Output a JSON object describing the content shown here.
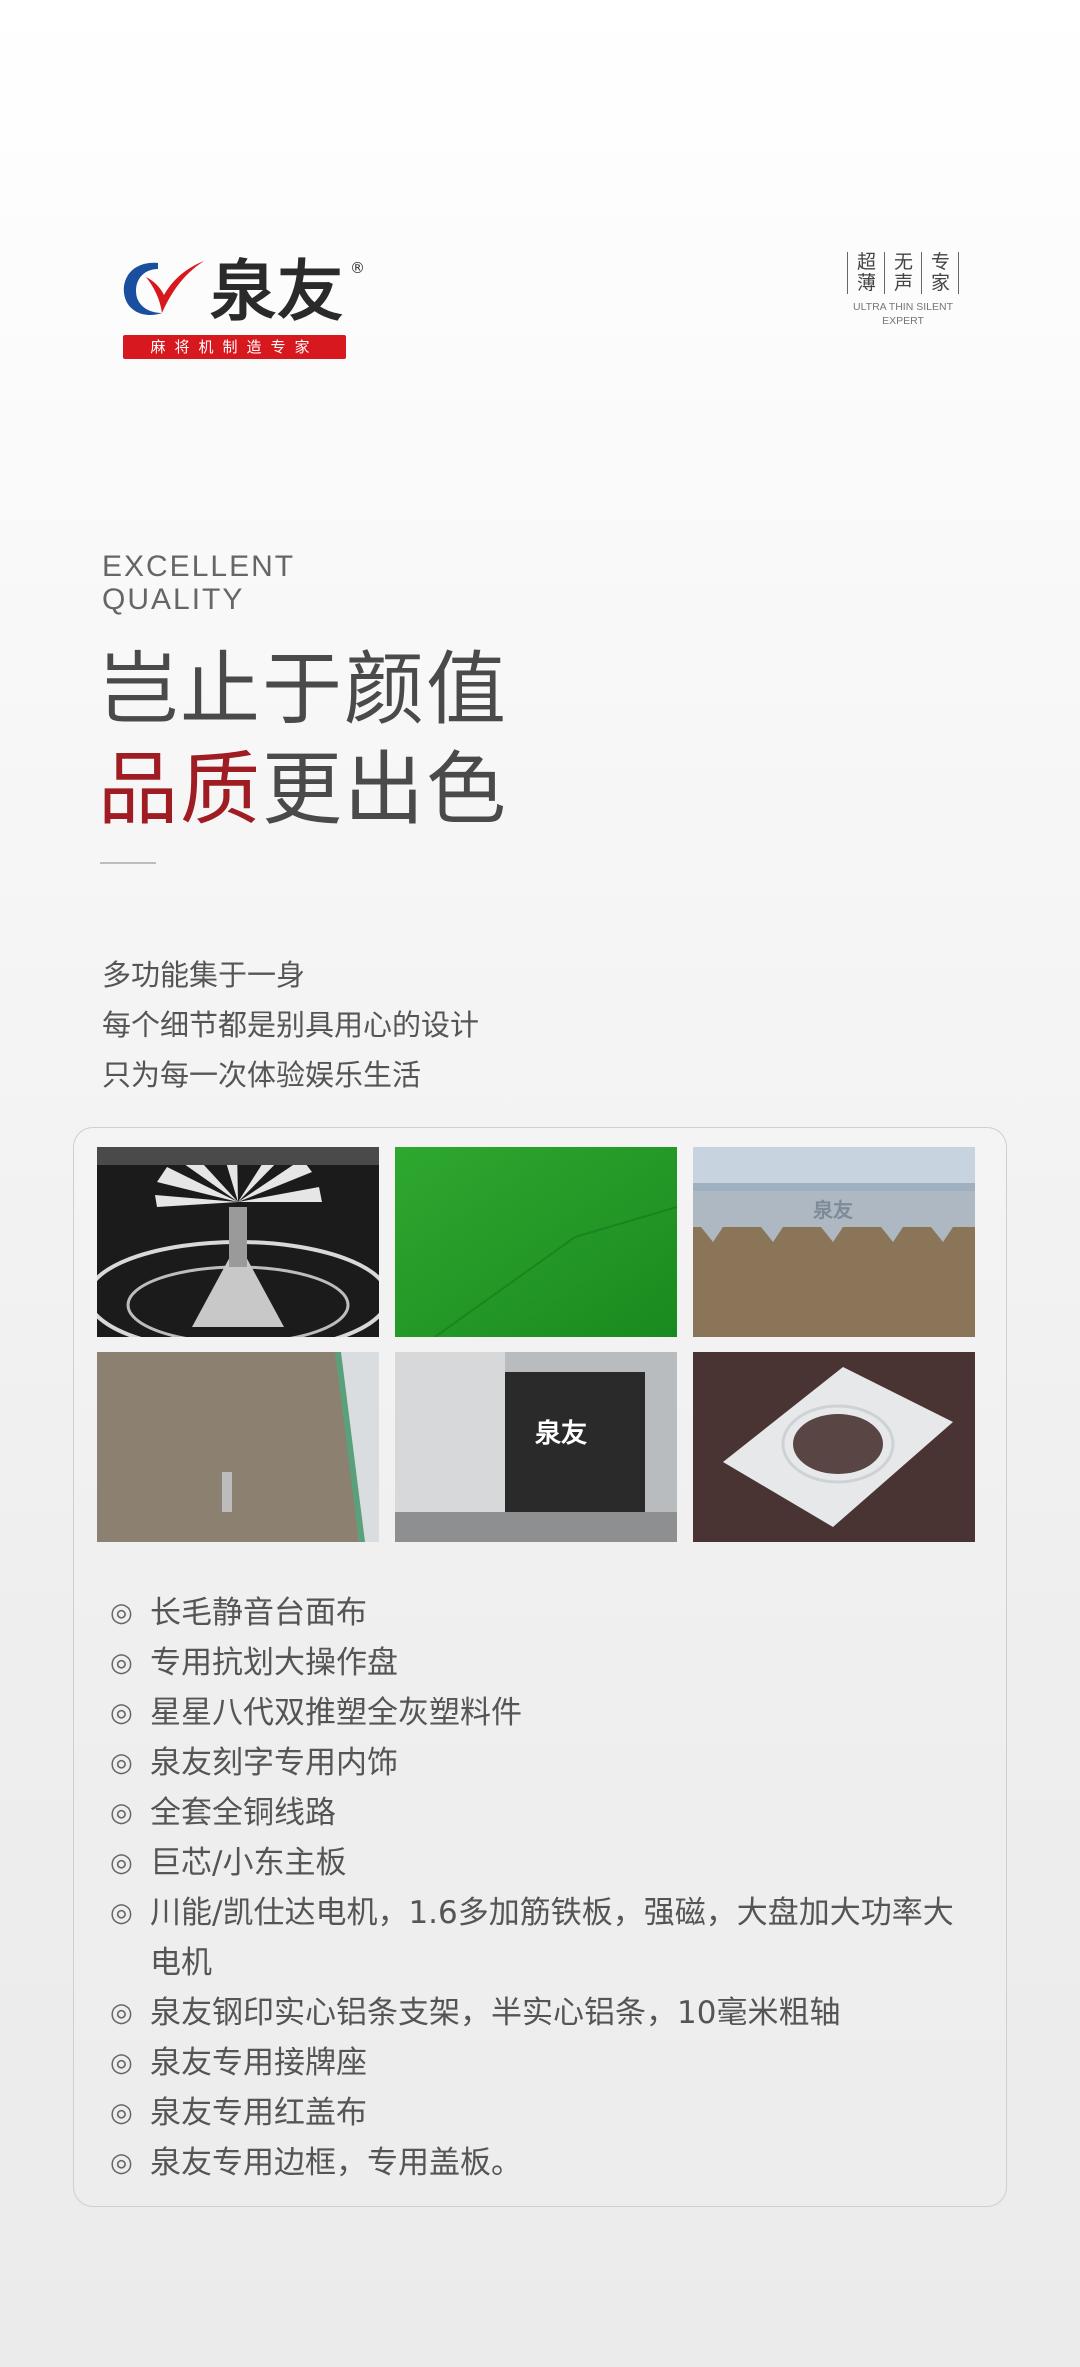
{
  "brand": {
    "name": "泉友",
    "registered": "®",
    "tagline": "麻将机制造专家"
  },
  "slogan": {
    "columns": [
      "超薄",
      "无声",
      "专家"
    ],
    "english_line1": "ULTRA THIN SILENT",
    "english_line2": "EXPERT"
  },
  "headline": {
    "english_line1": "EXCELLENT",
    "english_line2": "QUALITY",
    "line1": "岂止于颜值",
    "line2_red": "品质",
    "line2_rest": "更出色"
  },
  "intro": [
    "多功能集于一身",
    "每个细节都是别具用心的设计",
    "只为每一次体验娱乐生活"
  ],
  "photos": [
    {
      "name": "photo-gear-mechanism"
    },
    {
      "name": "photo-green-table-cloth"
    },
    {
      "name": "photo-engraved-aluminum-strip",
      "text": "泉友"
    },
    {
      "name": "photo-edge-frame"
    },
    {
      "name": "photo-logo-component",
      "text": "泉友"
    },
    {
      "name": "photo-metal-plate"
    }
  ],
  "feature_bullet": "◎",
  "features": [
    "长毛静音台面布",
    "专用抗划大操作盘",
    "星星八代双推塑全灰塑料件",
    "泉友刻字专用内饰",
    "全套全铜线路",
    "巨芯/小东主板",
    "川能/凯仕达电机，1.6多加筋铁板，强磁，大盘加大功率大电机",
    "泉友钢印实心铝条支架，半实心铝条，10毫米粗轴",
    "泉友专用接牌座",
    "泉友专用红盖布",
    "泉友专用边框，专用盖板。"
  ],
  "colors": {
    "accent_red": "#9e1c22",
    "logo_blue": "#1a4fa0",
    "logo_red": "#d7191f"
  }
}
